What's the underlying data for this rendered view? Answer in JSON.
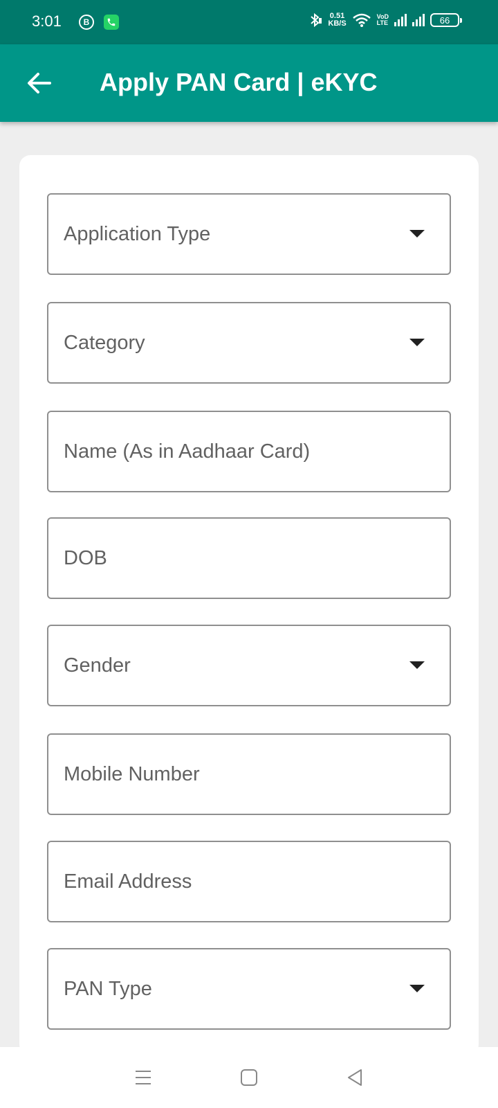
{
  "status_bar": {
    "time": "3:01",
    "b_badge": "B",
    "net_speed_value": "0.51",
    "net_speed_unit": "KB/S",
    "volte_top": "VoD",
    "volte_bottom": "LTE",
    "battery": "66"
  },
  "app_bar": {
    "title": "Apply PAN Card | eKYC",
    "back_icon": "arrow-left-icon"
  },
  "form": {
    "fields": [
      {
        "label": "Application Type",
        "type": "dropdown"
      },
      {
        "label": "Category",
        "type": "dropdown"
      },
      {
        "label": "Name (As in Aadhaar Card)",
        "type": "text"
      },
      {
        "label": "DOB",
        "type": "text"
      },
      {
        "label": "Gender",
        "type": "dropdown"
      },
      {
        "label": "Mobile Number",
        "type": "text"
      },
      {
        "label": "Email Address",
        "type": "text"
      },
      {
        "label": "PAN Type",
        "type": "dropdown"
      }
    ]
  },
  "nav_bar": {
    "icons": [
      "menu-icon",
      "home-icon",
      "back-icon"
    ]
  },
  "colors": {
    "status_bar": "#00796b",
    "app_bar": "#009688",
    "background": "#eeeeee",
    "field_border": "#8f8f8f"
  }
}
